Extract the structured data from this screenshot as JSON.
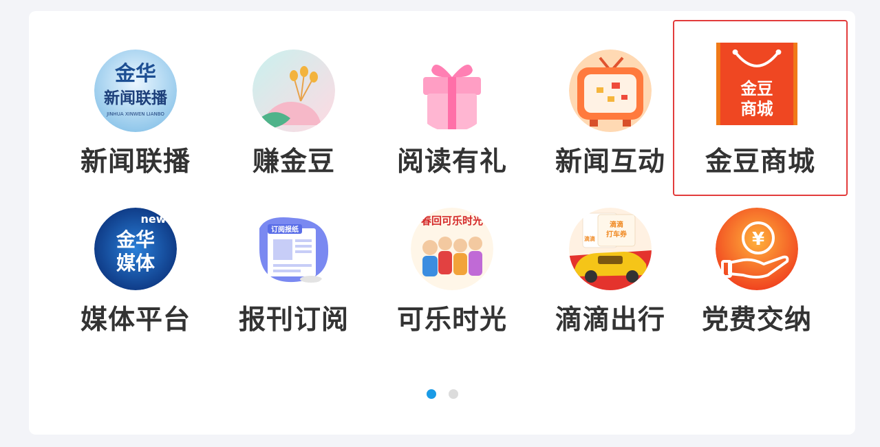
{
  "grid": {
    "items": [
      {
        "label": "新闻联播",
        "icon": "jinhua-news-broadcast-icon",
        "icon_text_top": "金华",
        "icon_text_mid": "新闻联播",
        "icon_text_small": "JINHUA XINWEN LIANBO"
      },
      {
        "label": "赚金豆",
        "icon": "earn-beans-flower-icon"
      },
      {
        "label": "阅读有礼",
        "icon": "gift-box-icon"
      },
      {
        "label": "新闻互动",
        "icon": "retro-tv-icon"
      },
      {
        "label": "金豆商城",
        "icon": "jindou-mall-bag-icon",
        "icon_text_1": "金豆",
        "icon_text_2": "商城"
      },
      {
        "label": "媒体平台",
        "icon": "jinhua-media-icon",
        "icon_text_small": "new",
        "icon_text_1": "金华",
        "icon_text_2": "媒体"
      },
      {
        "label": "报刊订阅",
        "icon": "newspaper-subscription-icon",
        "icon_text": "订阅报纸"
      },
      {
        "label": "可乐时光",
        "icon": "cola-time-icon",
        "icon_text": "春回可乐时光"
      },
      {
        "label": "滴滴出行",
        "icon": "didi-car-icon",
        "icon_text_1": "滴滴",
        "icon_text_2": "打车券",
        "icon_text_3": "滴滴"
      },
      {
        "label": "党费交纳",
        "icon": "party-fee-yuan-icon",
        "icon_text": "¥"
      }
    ],
    "selected_index": 4
  },
  "pagination": {
    "pages": 2,
    "current": 1
  },
  "colors": {
    "accent": "#1a9be6",
    "selection": "#e23b3b",
    "text": "#333333"
  }
}
